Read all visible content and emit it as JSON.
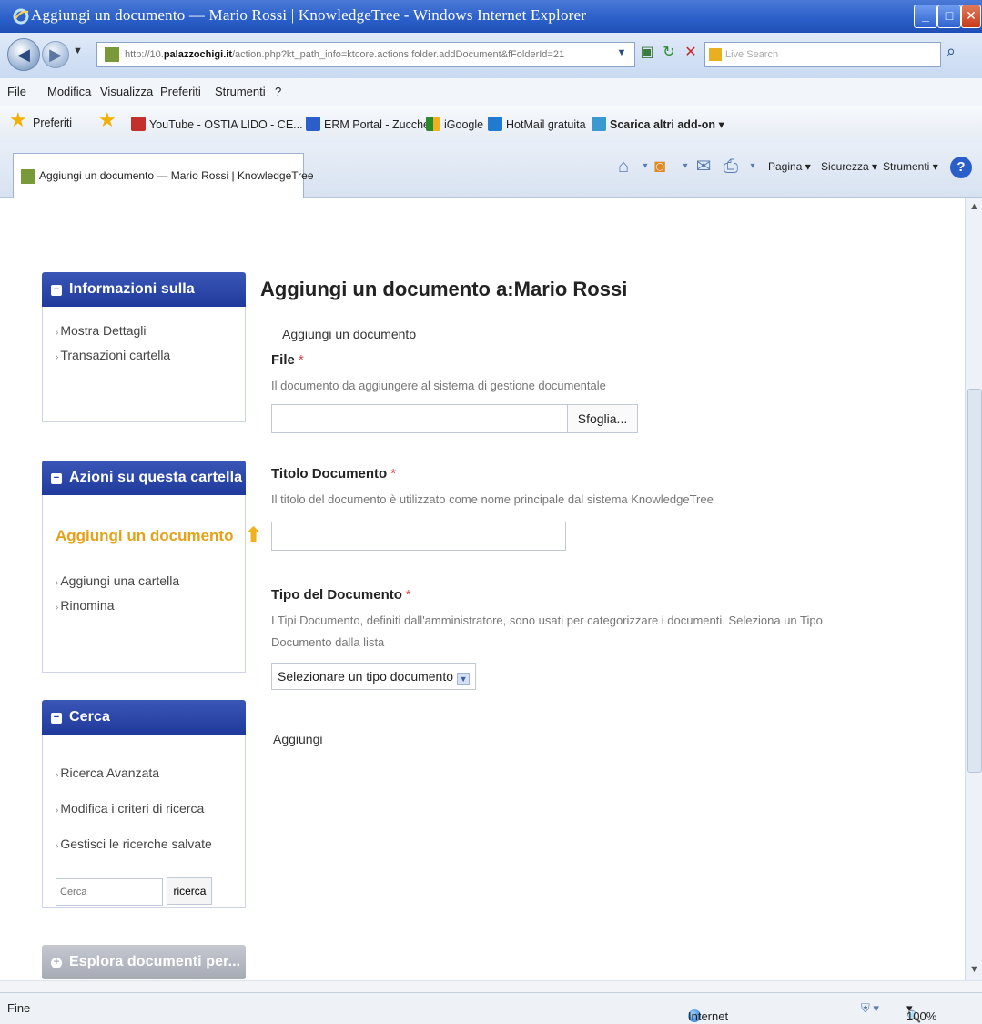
{
  "window": {
    "title": "Aggiungi un documento — Mario Rossi | KnowledgeTree - Windows Internet Explorer"
  },
  "address": {
    "url_prefix": "http://10.",
    "url_host": "palazzochigi.it",
    "url_rest": "/action.php?kt_path_info=ktcore.actions.folder.addDocument&fFolderId=21",
    "search_placeholder": "Live Search"
  },
  "menu": {
    "items": [
      "File",
      "Modifica",
      "Visualizza",
      "Preferiti",
      "Strumenti",
      "?"
    ]
  },
  "favorites": {
    "label": "Preferiti",
    "links": [
      "YouTube - OSTIA LIDO - CE...",
      "ERM Portal - Zucchetti",
      "iGoogle",
      "HotMail gratuita",
      "Scarica altri add-on"
    ]
  },
  "tab": {
    "label": "Aggiungi un documento — Mario Rossi | KnowledgeTree"
  },
  "commandbar": {
    "pagina": "Pagina",
    "sicurezza": "Sicurezza",
    "strumenti": "Strumenti"
  },
  "sidebar": {
    "folder_info": {
      "title": "Informazioni sulla Cartella",
      "links": [
        "Mostra Dettagli",
        "Transazioni cartella"
      ]
    },
    "folder_actions": {
      "title": "Azioni su questa cartella",
      "highlight": "Aggiungi un documento",
      "links": [
        "Aggiungi una cartella",
        "Rinomina"
      ]
    },
    "search": {
      "title": "Cerca",
      "links": [
        "Ricerca Avanzata",
        "Modifica i criteri di ricerca",
        "Gestisci le ricerche salvate"
      ],
      "input_placeholder": "Cerca",
      "button": "ricerca"
    },
    "browse": {
      "title": "Esplora documenti per..."
    }
  },
  "main": {
    "heading": "Aggiungi un documento a:Mario Rossi",
    "section": "Aggiungi un documento",
    "file": {
      "label": "File",
      "required": "*",
      "description": "Il documento da aggiungere al sistema di gestione documentale",
      "browse": "Sfoglia..."
    },
    "title": {
      "label": "Titolo Documento",
      "required": "*",
      "description": "Il titolo del documento è utilizzato come nome principale dal sistema KnowledgeTree"
    },
    "type": {
      "label": "Tipo del Documento",
      "required": "*",
      "description": "I Tipi Documento, definiti dall'amministratore, sono usati per categorizzare i documenti. Seleziona un Tipo Documento dalla lista",
      "selected": "Selezionare un tipo documento"
    },
    "submit": "Aggiungi"
  },
  "status": {
    "left": "Fine",
    "zone": "Internet",
    "zoom": "100%"
  }
}
